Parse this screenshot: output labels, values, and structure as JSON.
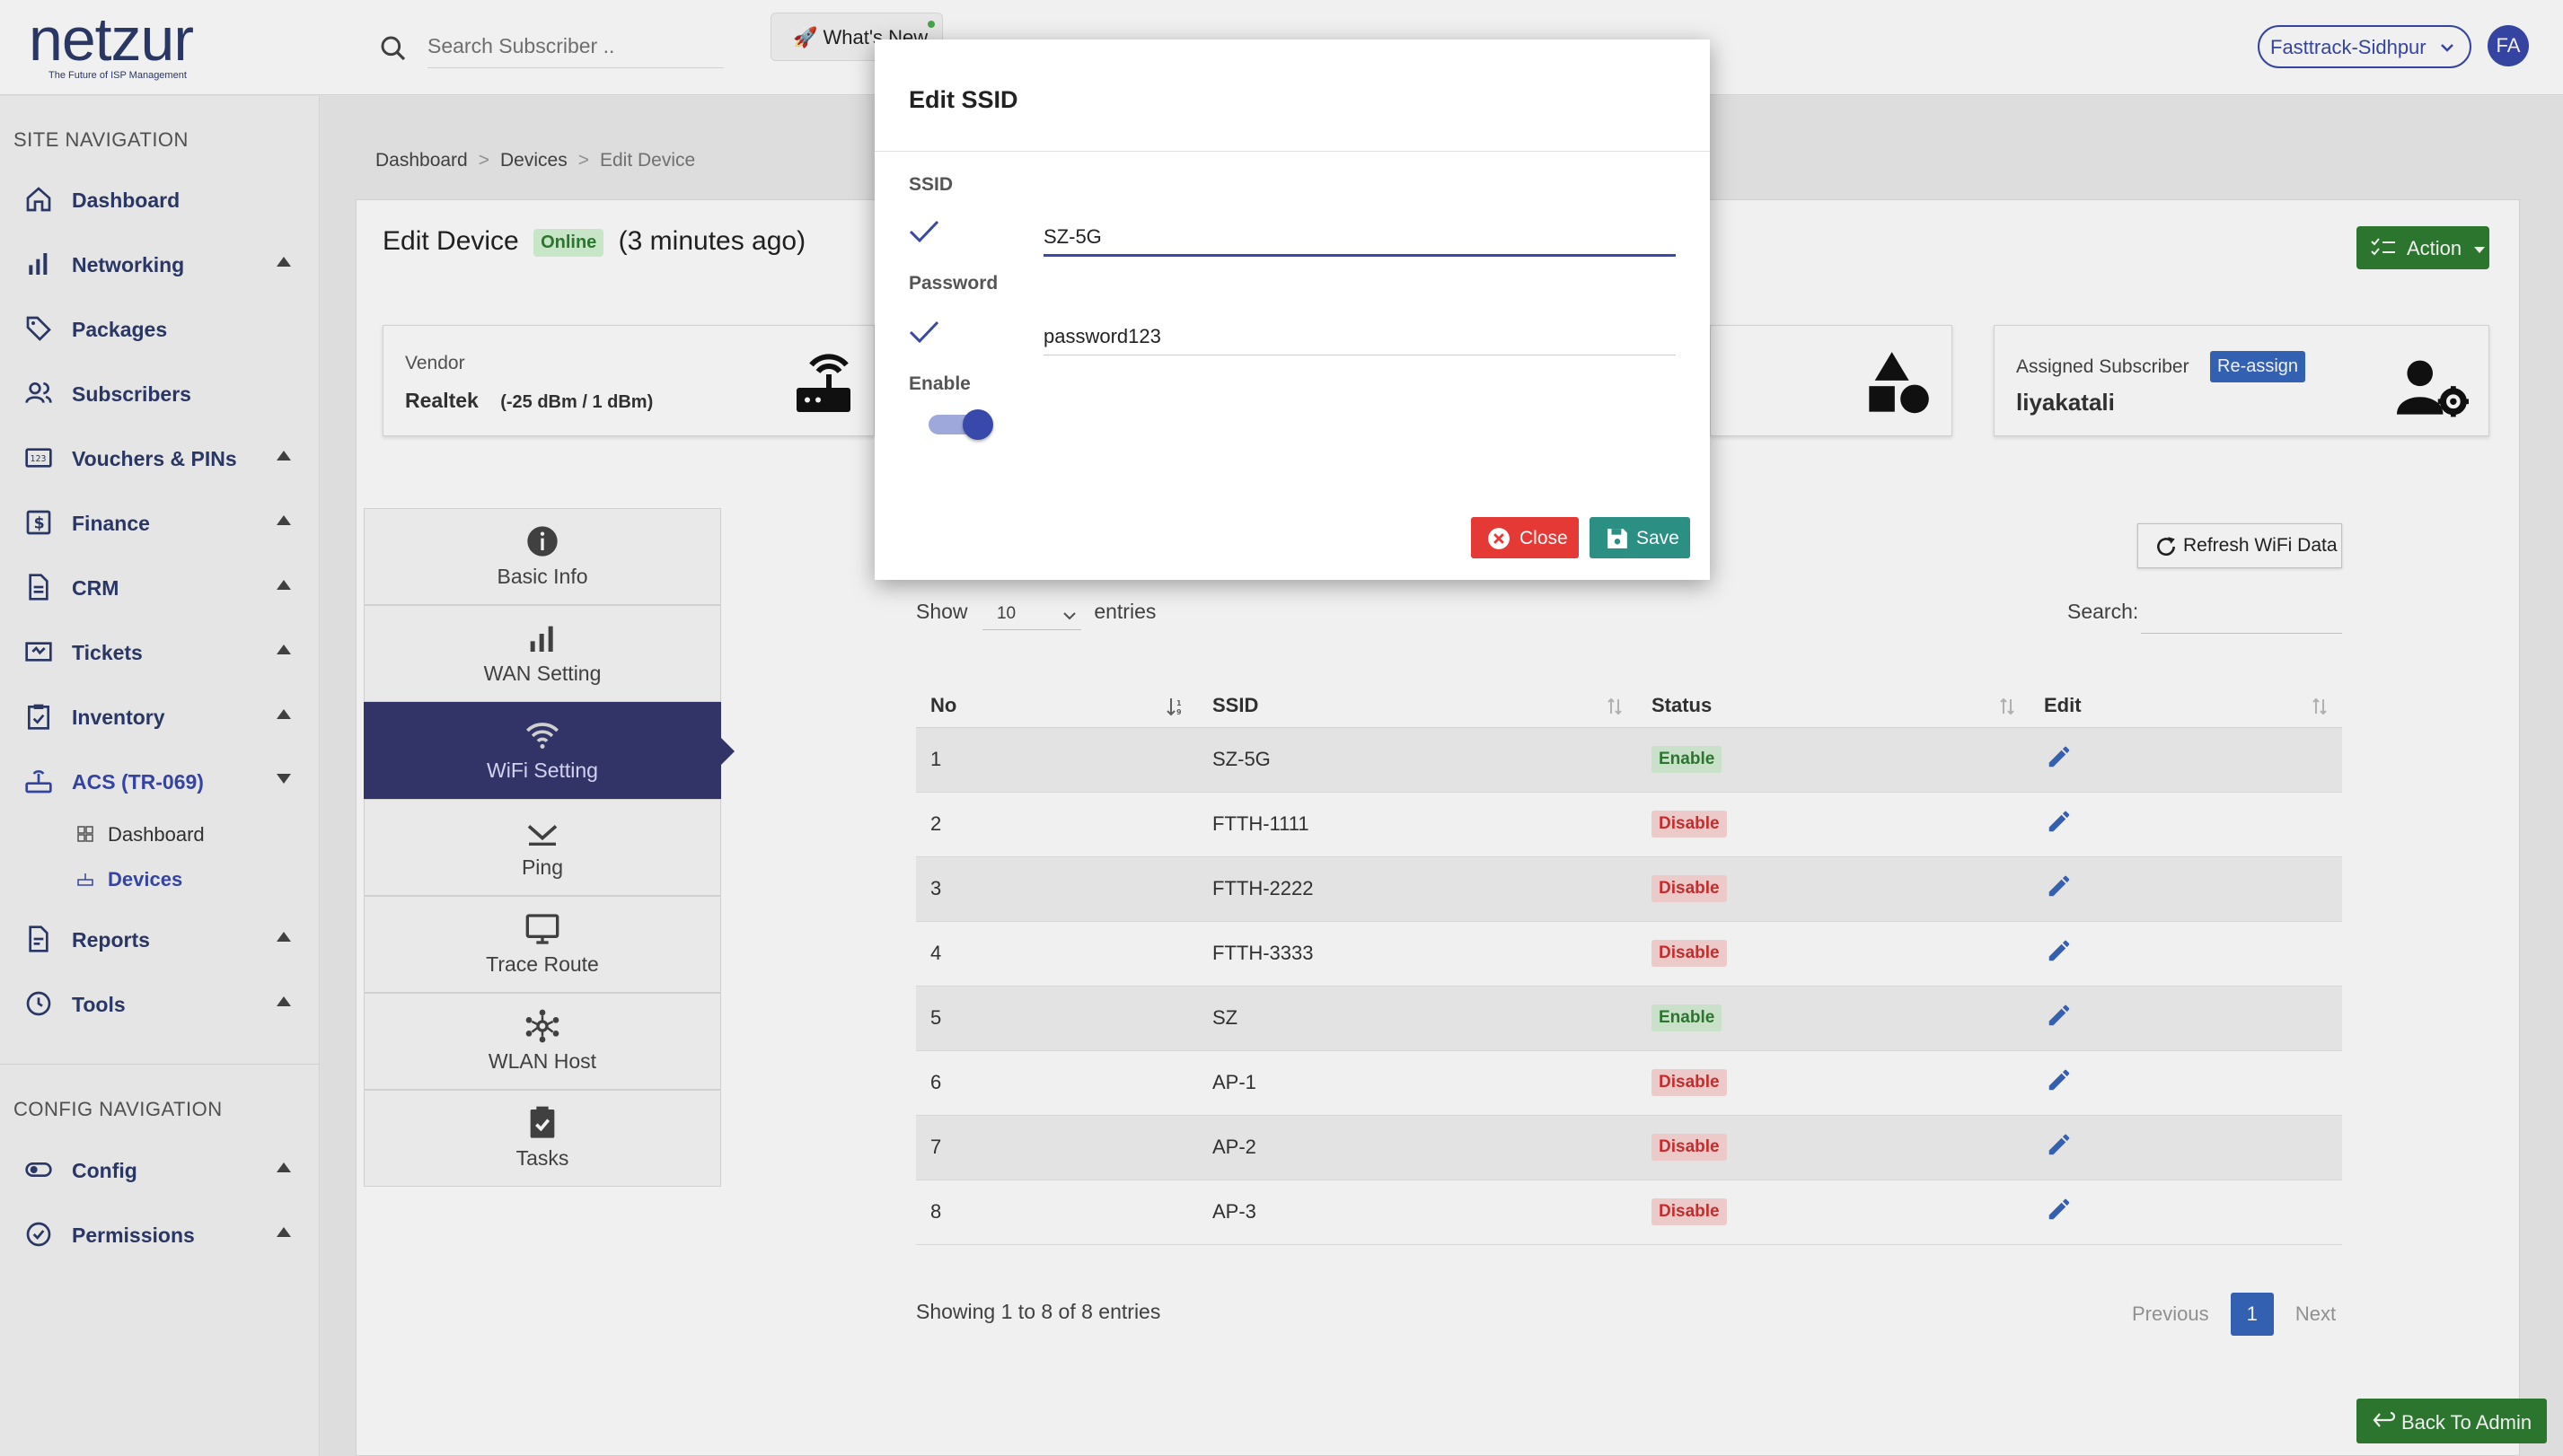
{
  "brand": {
    "name": "netzur",
    "tagline": "The Future of ISP Management"
  },
  "topbar": {
    "search_placeholder": "Search Subscriber ..",
    "whats_new": "🚀 What's New",
    "site": "Fasttrack-Sidhpur",
    "avatar_initials": "FA"
  },
  "sidebar": {
    "site_nav_title": "SITE NAVIGATION",
    "items": [
      {
        "label": "Dashboard",
        "icon": "home-icon"
      },
      {
        "label": "Networking",
        "icon": "bar-chart-icon"
      },
      {
        "label": "Packages",
        "icon": "tag-icon"
      },
      {
        "label": "Subscribers",
        "icon": "users-icon"
      },
      {
        "label": "Vouchers & PINs",
        "icon": "voucher-icon"
      },
      {
        "label": "Finance",
        "icon": "dollar-icon"
      },
      {
        "label": "CRM",
        "icon": "document-icon"
      },
      {
        "label": "Tickets",
        "icon": "ticket-icon"
      },
      {
        "label": "Inventory",
        "icon": "clipboard-icon"
      },
      {
        "label": "ACS (TR-069)",
        "icon": "router-icon"
      },
      {
        "label": "Reports",
        "icon": "report-icon"
      },
      {
        "label": "Tools",
        "icon": "tools-icon"
      }
    ],
    "acs_sub": [
      {
        "label": "Dashboard"
      },
      {
        "label": "Devices"
      }
    ],
    "config_nav_title": "CONFIG NAVIGATION",
    "config_items": [
      {
        "label": "Config"
      },
      {
        "label": "Permissions"
      }
    ]
  },
  "breadcrumb": {
    "items": [
      "Dashboard",
      "Devices",
      "Edit Device"
    ]
  },
  "page": {
    "title": "Edit Device",
    "status": "Online",
    "last_seen": "(3 minutes ago)",
    "action": "Action"
  },
  "vendor_box": {
    "label": "Vendor",
    "value": "Realtek",
    "signal": "(-25 dBm / 1 dBm)"
  },
  "subscriber_box": {
    "label": "Assigned Subscriber",
    "reassign": "Re-assign",
    "value": "liyakatali"
  },
  "tabs": [
    {
      "label": "Basic Info"
    },
    {
      "label": "WAN Setting"
    },
    {
      "label": "WiFi Setting"
    },
    {
      "label": "Ping"
    },
    {
      "label": "Trace Route"
    },
    {
      "label": "WLAN Host"
    },
    {
      "label": "Tasks"
    }
  ],
  "wifi": {
    "refresh": "Refresh WiFi Data",
    "show": "Show",
    "entries_value": "10",
    "entries": "entries",
    "search": "Search:",
    "columns": [
      "No",
      "SSID",
      "Status",
      "Edit"
    ],
    "rows": [
      {
        "no": "1",
        "ssid": "SZ-5G",
        "status": "Enable"
      },
      {
        "no": "2",
        "ssid": "FTTH-1111",
        "status": "Disable"
      },
      {
        "no": "3",
        "ssid": "FTTH-2222",
        "status": "Disable"
      },
      {
        "no": "4",
        "ssid": "FTTH-3333",
        "status": "Disable"
      },
      {
        "no": "5",
        "ssid": "SZ",
        "status": "Enable"
      },
      {
        "no": "6",
        "ssid": "AP-1",
        "status": "Disable"
      },
      {
        "no": "7",
        "ssid": "AP-2",
        "status": "Disable"
      },
      {
        "no": "8",
        "ssid": "AP-3",
        "status": "Disable"
      }
    ],
    "footer": "Showing 1 to 8 of 8 entries",
    "previous": "Previous",
    "page": "1",
    "next": "Next"
  },
  "back_to_admin": "Back To Admin",
  "modal": {
    "title": "Edit SSID",
    "ssid_label": "SSID",
    "ssid_value": "SZ-5G",
    "password_label": "Password",
    "password_value": "password123",
    "enable_label": "Enable",
    "enabled": true,
    "close": "Close",
    "save": "Save"
  },
  "colors": {
    "brand": "#2d3a6b",
    "accent": "#3949ab",
    "success": "#2e7d32",
    "danger": "#e53935"
  }
}
